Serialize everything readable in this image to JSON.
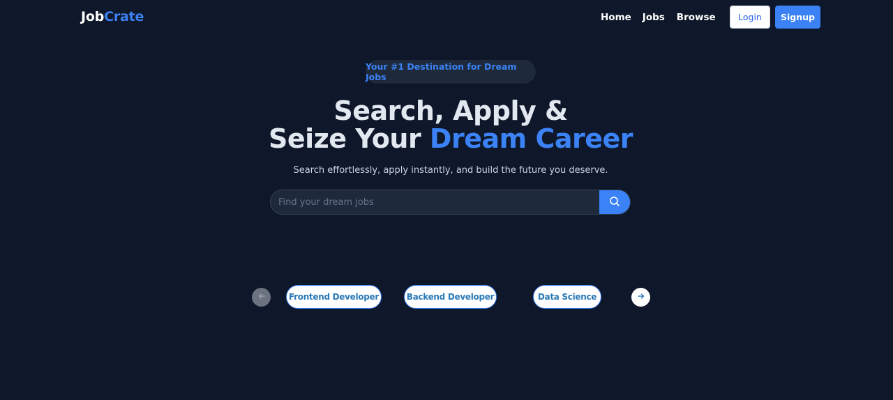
{
  "navbar": {
    "logo_part1": "Job",
    "logo_part2": "Crate",
    "links": [
      "Home",
      "Jobs",
      "Browse"
    ],
    "login_label": "Login",
    "signup_label": "Signup"
  },
  "hero": {
    "badge": "Your #1 Destination for Dream Jobs",
    "title_line1": "Search, Apply &",
    "title_line2_plain": "Seize Your ",
    "title_line2_accent": "Dream Career",
    "subtitle": "Search effortlessly, apply instantly, and build the future you deserve."
  },
  "search": {
    "placeholder": "Find your dream jobs",
    "value": "",
    "button_icon": "search-icon"
  },
  "carousel": {
    "prev_icon": "arrow-left-icon",
    "next_icon": "arrow-right-icon",
    "categories": [
      "Frontend Developer",
      "Backend Developer",
      "Data Science"
    ]
  },
  "colors": {
    "background": "#0f172a",
    "accent": "#3b82f6",
    "surface": "#1e293b"
  }
}
